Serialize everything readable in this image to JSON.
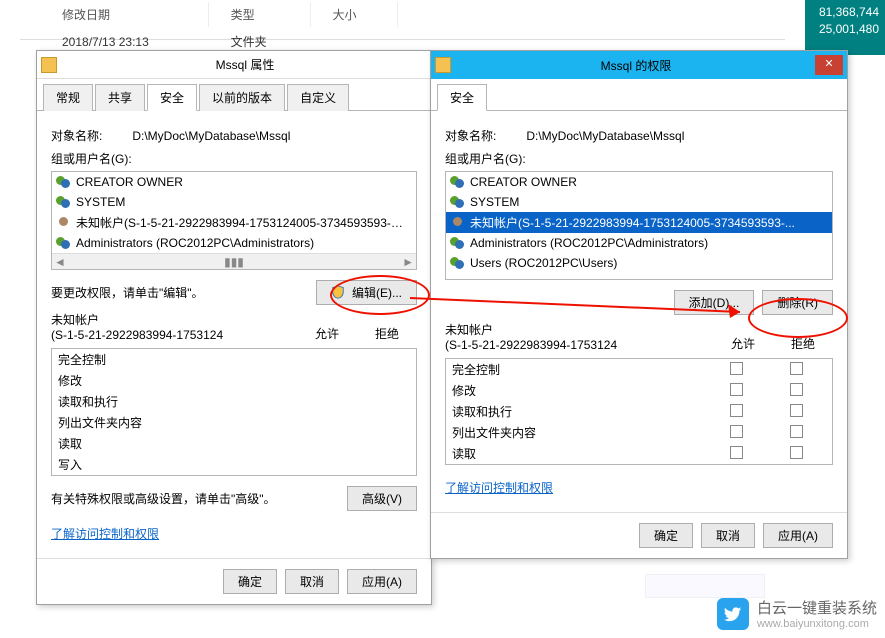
{
  "desktop": {
    "stats": [
      "81,368,744",
      "25,001,480"
    ]
  },
  "explorer": {
    "cols": {
      "modified": "修改日期",
      "type": "类型",
      "size": "大小"
    },
    "row": {
      "modified": "2018/7/13 23:13",
      "type": "文件夹",
      "size": ""
    }
  },
  "dlg1": {
    "title": "Mssql 属性",
    "tabs": {
      "general": "常规",
      "sharing": "共享",
      "security": "安全",
      "prev": "以前的版本",
      "custom": "自定义"
    },
    "object_label": "对象名称:",
    "object_path": "D:\\MyDoc\\MyDatabase\\Mssql",
    "groups_label": "组或用户名(G):",
    "groups": [
      {
        "name": "CREATOR OWNER"
      },
      {
        "name": "SYSTEM"
      },
      {
        "name": "未知帐户(S-1-5-21-2922983994-1753124005-3734593593-…"
      },
      {
        "name": "Administrators (ROC2012PC\\Administrators)"
      }
    ],
    "edit_hint": "要更改权限，请单击\"编辑\"。",
    "edit_btn": "编辑(E)...",
    "perm_for_1": "未知帐户",
    "perm_for_2": "(S-1-5-21-2922983994-1753124",
    "allow": "允许",
    "deny": "拒绝",
    "perms": [
      "完全控制",
      "修改",
      "读取和执行",
      "列出文件夹内容",
      "读取",
      "写入"
    ],
    "adv_hint": "有关特殊权限或高级设置，请单击\"高级\"。",
    "adv_btn": "高级(V)",
    "help_link": "了解访问控制和权限",
    "ok": "确定",
    "cancel": "取消",
    "apply": "应用(A)"
  },
  "dlg2": {
    "title": "Mssql 的权限",
    "tab": "安全",
    "object_label": "对象名称:",
    "object_path": "D:\\MyDoc\\MyDatabase\\Mssql",
    "groups_label": "组或用户名(G):",
    "groups": [
      {
        "name": "CREATOR OWNER",
        "sel": false
      },
      {
        "name": "SYSTEM",
        "sel": false
      },
      {
        "name": "未知帐户(S-1-5-21-2922983994-1753124005-3734593593-...",
        "sel": true
      },
      {
        "name": "Administrators (ROC2012PC\\Administrators)",
        "sel": false
      },
      {
        "name": "Users (ROC2012PC\\Users)",
        "sel": false
      }
    ],
    "add_btn": "添加(D)...",
    "remove_btn": "删除(R)",
    "perm_for_1": "未知帐户",
    "perm_for_2": "(S-1-5-21-2922983994-1753124",
    "allow": "允许",
    "deny": "拒绝",
    "perms": [
      "完全控制",
      "修改",
      "读取和执行",
      "列出文件夹内容",
      "读取"
    ],
    "help_link": "了解访问控制和权限",
    "ok": "确定",
    "cancel": "取消",
    "apply": "应用(A)"
  },
  "watermark": {
    "brand": "白云一键重装系统",
    "url": "www.baiyunxitong.com"
  }
}
